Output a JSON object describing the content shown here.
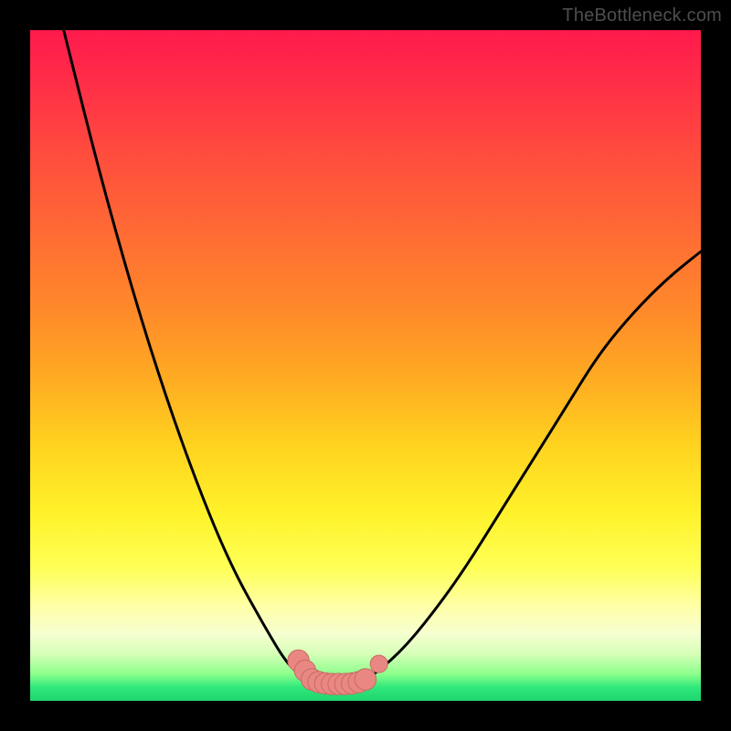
{
  "watermark": "TheBottleneck.com",
  "colors": {
    "frame": "#000000",
    "curve": "#000000",
    "marker": "#e98782",
    "marker_stroke": "#c96a66"
  },
  "chart_data": {
    "type": "line",
    "title": "",
    "xlabel": "",
    "ylabel": "",
    "xlim": [
      0,
      100
    ],
    "ylim": [
      0,
      100
    ],
    "grid": false,
    "legend": false,
    "series": [
      {
        "name": "left-branch",
        "x": [
          5,
          10,
          15,
          20,
          25,
          30,
          35,
          38,
          40,
          42
        ],
        "y": [
          100,
          80,
          62,
          46,
          32,
          20,
          11,
          6,
          4,
          3
        ]
      },
      {
        "name": "floor",
        "x": [
          42,
          44,
          46,
          48,
          50
        ],
        "y": [
          3,
          2.5,
          2.5,
          2.6,
          3
        ]
      },
      {
        "name": "right-branch",
        "x": [
          50,
          55,
          60,
          65,
          70,
          75,
          80,
          85,
          90,
          95,
          100
        ],
        "y": [
          3,
          7,
          13,
          20,
          28,
          36,
          44,
          52,
          58,
          63,
          67
        ]
      }
    ],
    "markers": [
      {
        "x": 40,
        "y": 6,
        "r": 1.6
      },
      {
        "x": 41,
        "y": 4.5,
        "r": 1.6
      },
      {
        "x": 42,
        "y": 3.2,
        "r": 1.6
      },
      {
        "x": 43,
        "y": 2.8,
        "r": 1.6
      },
      {
        "x": 44,
        "y": 2.6,
        "r": 1.6
      },
      {
        "x": 45,
        "y": 2.5,
        "r": 1.6
      },
      {
        "x": 46,
        "y": 2.5,
        "r": 1.6
      },
      {
        "x": 47,
        "y": 2.5,
        "r": 1.6
      },
      {
        "x": 48,
        "y": 2.6,
        "r": 1.6
      },
      {
        "x": 49,
        "y": 2.8,
        "r": 1.6
      },
      {
        "x": 50,
        "y": 3.2,
        "r": 1.6
      },
      {
        "x": 52,
        "y": 5.5,
        "r": 1.3
      }
    ]
  }
}
